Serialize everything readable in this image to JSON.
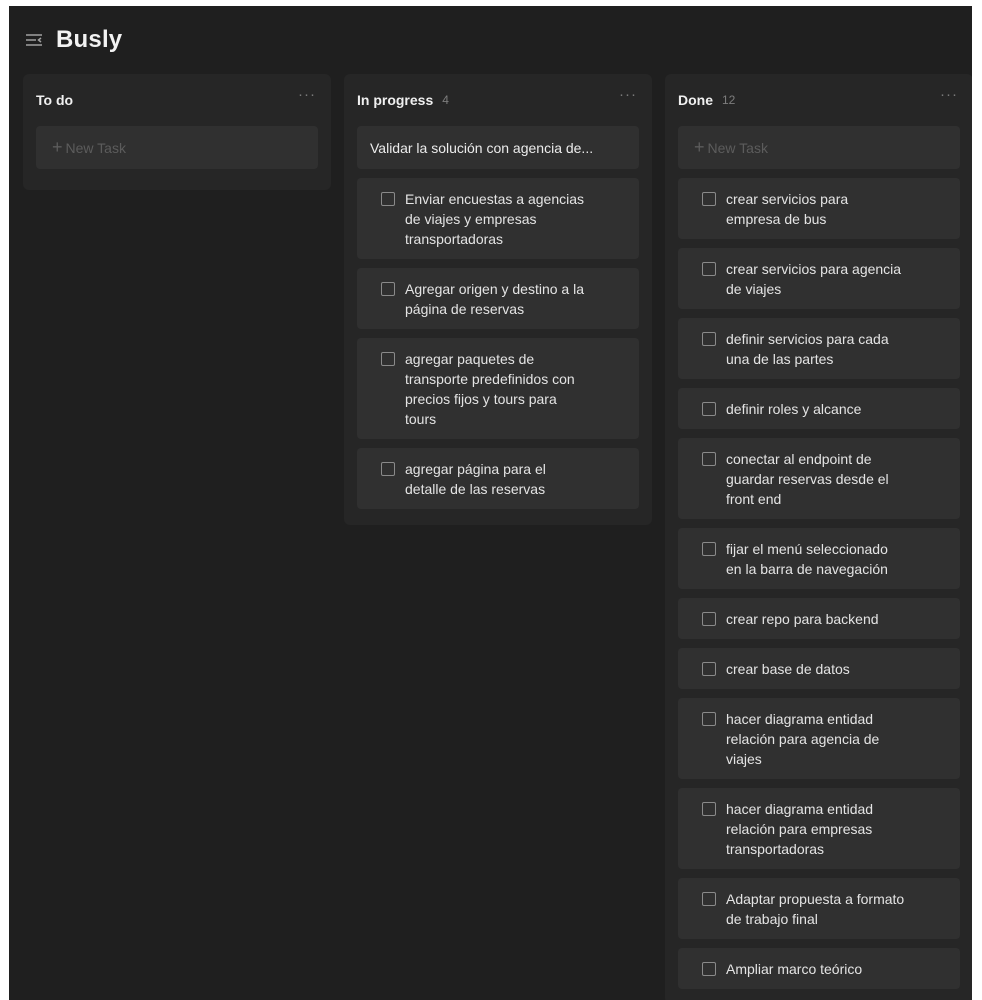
{
  "app": {
    "title": "Busly",
    "menu_icon": "sidebar-menu-icon"
  },
  "columns": {
    "todo": {
      "title": "To do",
      "count": "",
      "new_task": "New Task"
    },
    "inprogress": {
      "title": "In progress",
      "count": "4",
      "highlight": "Validar la solución con agencia de...",
      "cards": [
        "Enviar encuestas a agencias de viajes y empresas transportadoras",
        "Agregar origen y destino a la página de reservas",
        "agregar paquetes de transporte predefinidos con precios fijos y tours para tours",
        "agregar página para el detalle de las reservas"
      ]
    },
    "done": {
      "title": "Done",
      "count": "12",
      "new_task": "New Task",
      "cards": [
        "crear servicios para empresa de bus",
        "crear servicios para agencia de viajes",
        "definir servicios para cada una de las partes",
        "definir roles y alcance",
        "conectar al endpoint de guardar reservas desde el front end",
        "fijar el menú seleccionado en la barra de navegación",
        "crear repo para backend",
        "crear base de datos",
        "hacer diagrama entidad relación para agencia de viajes",
        "hacer diagrama entidad relación para empresas transportadoras",
        "Adaptar propuesta a formato de trabajo final",
        "Ampliar marco teórico"
      ]
    }
  },
  "more_label": "···",
  "plus_label": "+",
  "colors": {
    "background": "#1f1f1f",
    "column": "#262626",
    "card": "#303030",
    "text": "#e4e4e4",
    "muted": "#5c5c5c"
  }
}
